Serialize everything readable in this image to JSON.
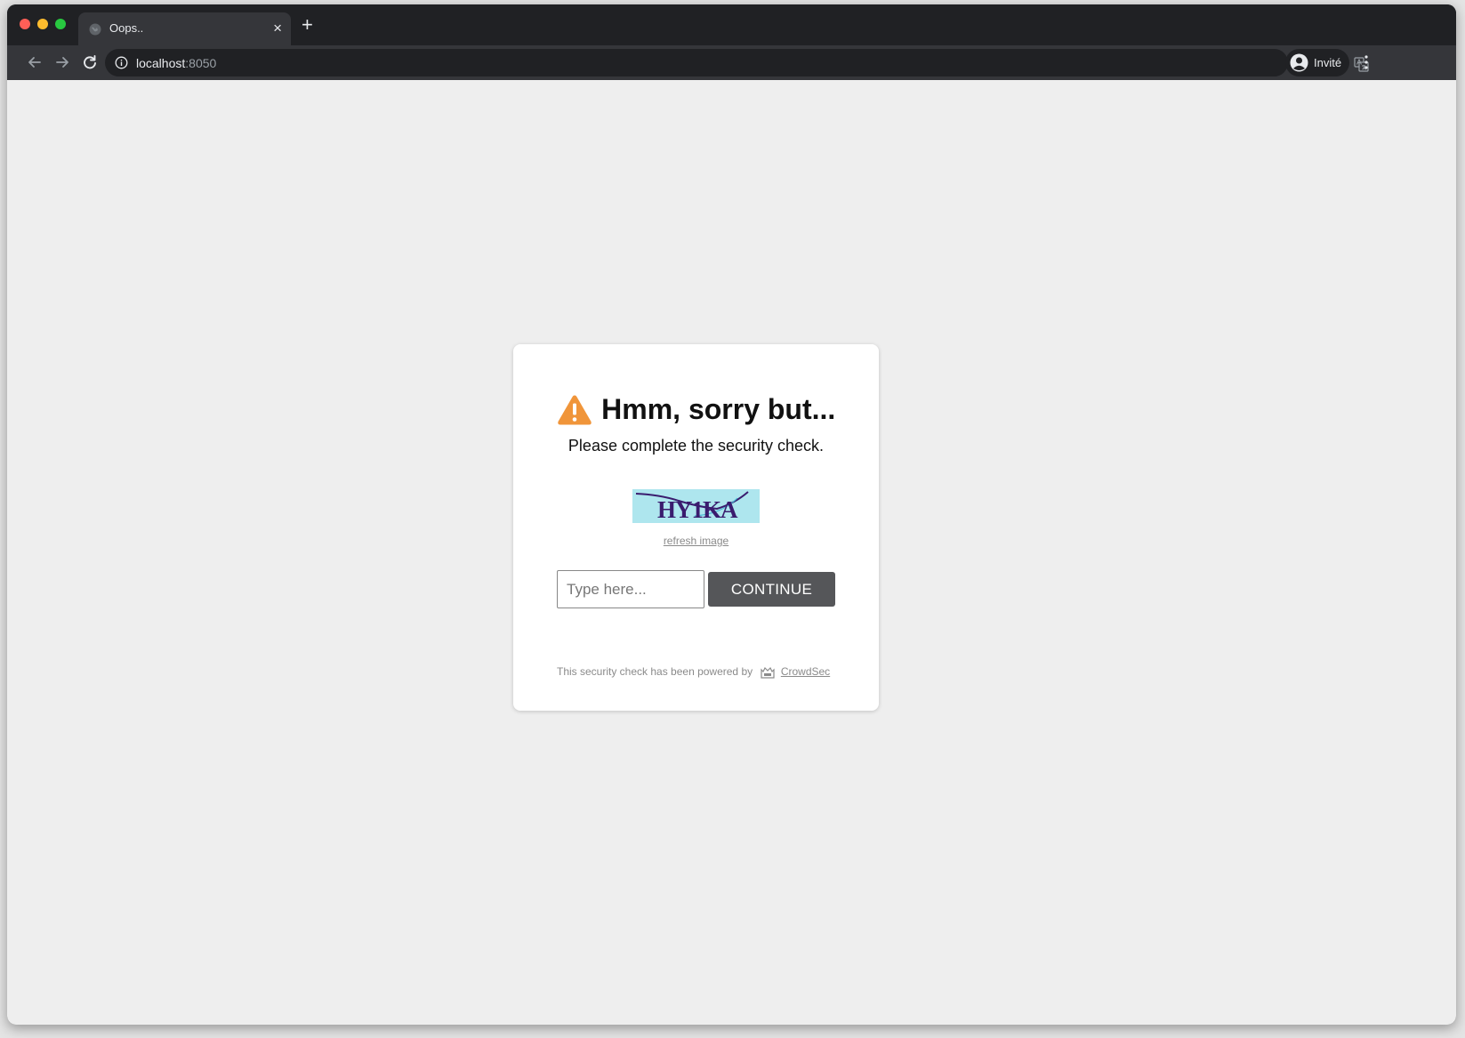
{
  "browser": {
    "tab": {
      "title": "Oops..",
      "close_glyph": "×"
    },
    "new_tab_glyph": "+",
    "address": {
      "host": "localhost",
      "port": ":8050"
    },
    "profile": {
      "label": "Invité"
    },
    "icons": [
      "back-arrow-icon",
      "forward-arrow-icon",
      "reload-icon",
      "info-icon",
      "translate-icon",
      "profile-icon",
      "kebab-menu-icon",
      "globe-icon"
    ]
  },
  "page": {
    "title": "Hmm, sorry but...",
    "subtitle": "Please complete the security check.",
    "captcha_text": "HY1KA",
    "refresh_label": "refresh image",
    "input_placeholder": "Type here...",
    "continue_label": "CONTINUE",
    "footer_text": "This security check has been powered by",
    "footer_link": "CrowdSec",
    "colors": {
      "warning": "#f0953a",
      "button": "#555659",
      "captcha_bg": "#aee6ee",
      "captcha_text": "#3a1c6e"
    }
  }
}
